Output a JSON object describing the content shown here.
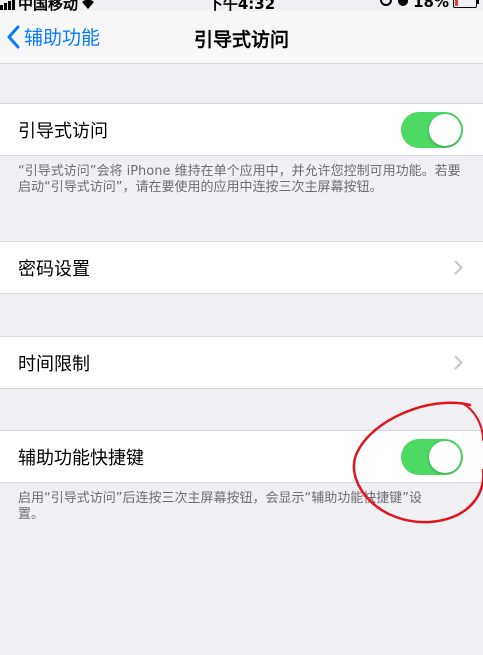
{
  "status_bar": {
    "carrier": "中国移动",
    "time": "下午4:32",
    "battery": "18%"
  },
  "nav": {
    "back_label": "辅助功能",
    "title": "引导式访问"
  },
  "guided_access": {
    "label": "引导式访问",
    "enabled": true,
    "description": "“引导式访问”会将 iPhone 维持在单个应用中，并允许您控制可用功能。若要启动“引导式访问”，请在要使用的应用中连按三次主屏幕按钮。"
  },
  "passcode_settings": {
    "label": "密码设置"
  },
  "time_limits": {
    "label": "时间限制"
  },
  "accessibility_shortcut": {
    "label": "辅助功能快捷键",
    "enabled": true,
    "description": "启用“引导式访问”后连按三次主屏幕按钮，会显示“辅助功能快捷键”设置。"
  },
  "colors": {
    "accent": "#0a7aff",
    "switch_on": "#4cd964",
    "annotation": "#e0141e"
  }
}
